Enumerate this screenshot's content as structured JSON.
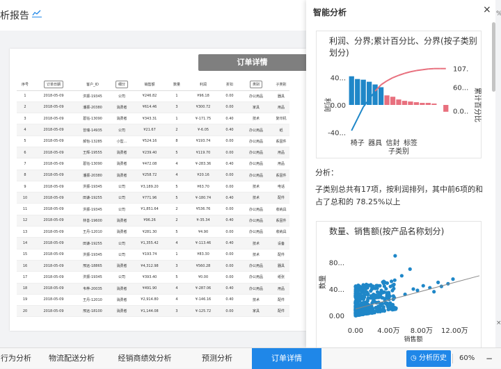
{
  "header": {
    "title": "析报告"
  },
  "report": {
    "title": "订单详情",
    "columns": [
      "序号",
      "订单日期",
      "客户_ID",
      "细分",
      "销售额",
      "数量",
      "利润",
      "折扣",
      "类别",
      "子类别"
    ],
    "rows": [
      [
        "1",
        "2018-05-09",
        "洪振-19345",
        "公司",
        "¥246.82",
        "1",
        "¥96.18",
        "0.00",
        "办公用品",
        "器具"
      ],
      [
        "2",
        "2018-05-09",
        "潘振-20380",
        "消费者",
        "¥614.46",
        "3",
        "¥300.72",
        "0.00",
        "家具",
        "用品"
      ],
      [
        "3",
        "2018-05-09",
        "葛钰-13090",
        "消费者",
        "¥343.31",
        "1",
        "¥-171.75",
        "0.40",
        "技术",
        "复印机"
      ],
      [
        "4",
        "2018-05-09",
        "曾瑞-14935",
        "公司",
        "¥21.67",
        "2",
        "¥-6.05",
        "0.40",
        "办公用品",
        "纸"
      ],
      [
        "5",
        "2018-05-09",
        "郝怡-13285",
        "小型...",
        "¥524.16",
        "8",
        "¥193.74",
        "0.00",
        "办公用品",
        "系固件"
      ],
      [
        "6",
        "2018-05-09",
        "王辉-19555",
        "消费者",
        "¥239.40",
        "5",
        "¥119.70",
        "0.00",
        "办公用品",
        "用品"
      ],
      [
        "7",
        "2018-05-09",
        "葛钰-13090",
        "消费者",
        "¥472.08",
        "4",
        "¥-283.36",
        "0.40",
        "办公用品",
        "用品"
      ],
      [
        "8",
        "2018-05-09",
        "潘振-20380",
        "消费者",
        "¥258.72",
        "4",
        "¥20.16",
        "0.00",
        "办公用品",
        "系固件"
      ],
      [
        "9",
        "2018-05-09",
        "洪振-19345",
        "公司",
        "¥3,189.20",
        "5",
        "¥63.70",
        "0.00",
        "技术",
        "电话"
      ],
      [
        "10",
        "2018-05-09",
        "田谦-19255",
        "公司",
        "¥771.96",
        "5",
        "¥-180.74",
        "0.40",
        "技术",
        "配件"
      ],
      [
        "11",
        "2018-05-09",
        "洪振-19345",
        "公司",
        "¥1,851.64",
        "2",
        "¥536.76",
        "0.00",
        "办公用品",
        "收纳具"
      ],
      [
        "12",
        "2018-05-09",
        "林善-19600",
        "消费者",
        "¥96.26",
        "2",
        "¥-35.34",
        "0.40",
        "办公用品",
        "系固件"
      ],
      [
        "13",
        "2018-05-09",
        "王丹-12010",
        "消费者",
        "¥281.30",
        "5",
        "¥4.90",
        "0.00",
        "办公用品",
        "收纳具"
      ],
      [
        "14",
        "2018-05-09",
        "田谦-19255",
        "公司",
        "¥1,355.42",
        "4",
        "¥-113.46",
        "0.40",
        "技术",
        "设备"
      ],
      [
        "15",
        "2018-05-09",
        "洪振-19345",
        "公司",
        "¥193.74",
        "1",
        "¥83.30",
        "0.00",
        "技术",
        "配件"
      ],
      [
        "16",
        "2018-05-09",
        "邢远-18865",
        "消费者",
        "¥4,312.98",
        "3",
        "¥560.28",
        "0.00",
        "办公用品",
        "器具"
      ],
      [
        "17",
        "2018-05-09",
        "洪振-19345",
        "公司",
        "¥393.40",
        "5",
        "¥0.00",
        "0.00",
        "办公用品",
        "纸张"
      ],
      [
        "18",
        "2018-05-09",
        "韦桦-20035",
        "消费者",
        "¥491.90",
        "4",
        "¥-287.06",
        "0.40",
        "办公用品",
        "用品"
      ],
      [
        "19",
        "2018-05-09",
        "王丹-12010",
        "消费者",
        "¥2,914.80",
        "4",
        "¥-146.16",
        "0.40",
        "技术",
        "配件"
      ],
      [
        "20",
        "2018-05-09",
        "邢远-18100",
        "消费者",
        "¥1,144.08",
        "3",
        "¥-125.72",
        "0.00",
        "家具",
        "配件"
      ]
    ]
  },
  "panel": {
    "title": "智能分析",
    "close": "×",
    "analysis_label": "分析：",
    "analysis_text": "子类别总共有17项，按利润排列，其中前6项的和占了总和的 78.25%以上"
  },
  "chart_data": [
    {
      "type": "bar",
      "title": "利润、分界;累计百分比、分界(按子类别划分)",
      "xlabel": "子类别",
      "ylabel": "利润",
      "y2label": "累计百分比",
      "ylim": [
        -55,
        55
      ],
      "y2lim": [
        -80,
        110
      ],
      "yticks": [
        "40...",
        "0.00",
        "-40..."
      ],
      "y2ticks": [
        "107.",
        "60...",
        "0.0.."
      ],
      "categories": [
        "椅子",
        "器具",
        "信封",
        "标签"
      ],
      "values": [
        42,
        38,
        37,
        34,
        30,
        26,
        14,
        12,
        8,
        6,
        5,
        4,
        3,
        3,
        2,
        0,
        -10
      ],
      "cumulative": [
        -50,
        -20,
        10,
        30,
        50,
        66,
        76,
        84,
        90,
        95,
        99,
        102,
        104,
        106,
        107,
        107,
        107
      ],
      "colors": {
        "positive": "#1f87c8",
        "negative": "#e8707e",
        "line_low": "#1f87c8",
        "line_high": "#e8707e"
      }
    },
    {
      "type": "scatter",
      "title": "数量、销售额(按产品名称划分)",
      "xlabel": "销售额",
      "ylabel": "数量",
      "xlim": [
        -10000,
        150000
      ],
      "ylim": [
        -5,
        110
      ],
      "xticks": [
        "0.00",
        "4.00万",
        "8.00万",
        "12.00万"
      ],
      "yticks": [
        "80...",
        "40...",
        "0.00"
      ],
      "trend": [
        [
          0,
          10
        ],
        [
          150000,
          60
        ]
      ],
      "color": "#1f87c8"
    }
  ],
  "tabs": [
    {
      "label": "行为分析",
      "active": false
    },
    {
      "label": "物流配送分析",
      "active": false
    },
    {
      "label": "经销商绩效分析",
      "active": false
    },
    {
      "label": "预测分析",
      "active": false
    },
    {
      "label": "订单详情",
      "active": true
    }
  ],
  "footer": {
    "history_label": "分析历史",
    "zoom": "60%",
    "zoom_minus": "−"
  },
  "side_glyphs": [
    "%",
    "×"
  ]
}
